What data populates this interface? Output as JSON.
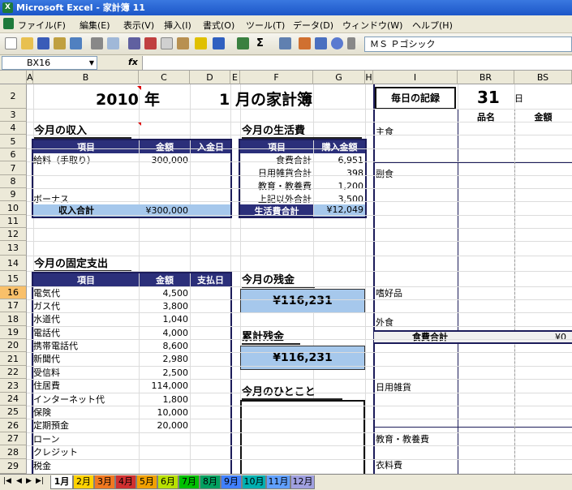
{
  "window": {
    "title": "Microsoft Excel - 家計簿 11",
    "app_icon": "excel-icon"
  },
  "menu": [
    "ファイル(F)",
    "編集(E)",
    "表示(V)",
    "挿入(I)",
    "書式(O)",
    "ツール(T)",
    "データ(D)",
    "ウィンドウ(W)",
    "ヘルプ(H)"
  ],
  "toolbar": {
    "font": "ＭＳ Ｐゴシック"
  },
  "formula": {
    "cell": "BX16",
    "fx": "fx"
  },
  "columns": [
    "A",
    "B",
    "C",
    "D",
    "E",
    "F",
    "G",
    "H",
    "I",
    "BR",
    "BS"
  ],
  "rows": [
    "2",
    "3",
    "4",
    "5",
    "6",
    "7",
    "8",
    "9",
    "10",
    "11",
    "12",
    "13",
    "14",
    "15",
    "16",
    "17",
    "18",
    "19",
    "20",
    "21",
    "22",
    "23",
    "24",
    "25",
    "26",
    "27",
    "28",
    "29"
  ],
  "header": {
    "year": "2010",
    "year_suffix": "年",
    "month": "1",
    "month_title": "月の家計簿"
  },
  "income": {
    "title": "今月の収入",
    "cols": [
      "項目",
      "金額",
      "入金日"
    ],
    "rows": [
      [
        "給料（手取り）",
        "300,000"
      ],
      [
        "",
        ""
      ],
      [
        "",
        ""
      ],
      [
        "ボーナス",
        ""
      ]
    ],
    "total_label": "収入合計",
    "total": "¥300,000"
  },
  "living": {
    "title": "今月の生活費",
    "cols": [
      "項目",
      "購入金額"
    ],
    "rows": [
      [
        "食費合計",
        "6,951"
      ],
      [
        "日用雑貨合計",
        "398"
      ],
      [
        "教育・教養費",
        "1,200"
      ],
      [
        "上記以外合計",
        "3,500"
      ]
    ],
    "total_label": "生活費合計",
    "total": "¥12,049"
  },
  "fixed": {
    "title": "今月の固定支出",
    "cols": [
      "項目",
      "金額",
      "支払日"
    ],
    "rows": [
      [
        "電気代",
        "4,500"
      ],
      [
        "ガス代",
        "3,800"
      ],
      [
        "水道代",
        "1,040"
      ],
      [
        "電話代",
        "4,000"
      ],
      [
        "携帯電話代",
        "8,600"
      ],
      [
        "新聞代",
        "2,980"
      ],
      [
        "受信料",
        "2,500"
      ],
      [
        "住居費",
        "114,000"
      ],
      [
        "インターネット代",
        "1,800"
      ],
      [
        "保険",
        "10,000"
      ],
      [
        "定期預金",
        "20,000"
      ],
      [
        "ローン",
        ""
      ],
      [
        "クレジット",
        ""
      ],
      [
        "税金",
        ""
      ]
    ]
  },
  "balance": {
    "title": "今月の残金",
    "value": "¥116,231"
  },
  "cumulative": {
    "title": "累計残金",
    "value": "¥116,231"
  },
  "memo": {
    "title": "今月のひとこと"
  },
  "daily": {
    "title": "毎日の記録",
    "day": "31",
    "day_unit": "日",
    "col1": "品名",
    "col2": "金額",
    "cats": [
      "主食",
      "副食",
      "嗜好品",
      "外食",
      "日用雑貨",
      "教育・教養費",
      "衣料費"
    ],
    "food_total_label": "食費合計",
    "food_total": "¥0"
  },
  "sheets": [
    "1月",
    "2月",
    "3月",
    "4月",
    "5月",
    "6月",
    "7月",
    "8月",
    "9月",
    "10月",
    "11月",
    "12月"
  ],
  "sheet_colors": [
    "#ffffff",
    "#ffd200",
    "#f07820",
    "#d03030",
    "#f0a000",
    "#b8e000",
    "#00c000",
    "#00a060",
    "#4080ff",
    "#00b0b0",
    "#60a0ff",
    "#a0a0e0"
  ]
}
